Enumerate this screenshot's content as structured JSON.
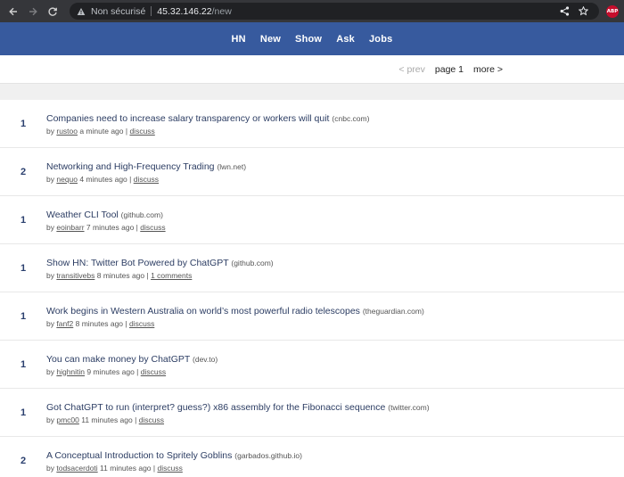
{
  "browser": {
    "insecure_label": "Non sécurisé",
    "host": "45.32.146.22",
    "path": "/new",
    "extension_label": "ABP"
  },
  "nav": {
    "items": [
      "HN",
      "New",
      "Show",
      "Ask",
      "Jobs"
    ]
  },
  "pager": {
    "prev": "< prev",
    "page": "page 1",
    "more": "more >"
  },
  "items": [
    {
      "score": "1",
      "title": "Companies need to increase salary transparency or workers will quit",
      "domain": "(cnbc.com)",
      "by": "by",
      "user": "rustoo",
      "time": "a minute ago |",
      "comments": "discuss"
    },
    {
      "score": "2",
      "title": "Networking and High-Frequency Trading",
      "domain": "(lwn.net)",
      "by": "by",
      "user": "nequo",
      "time": "4 minutes ago |",
      "comments": "discuss"
    },
    {
      "score": "1",
      "title": "Weather CLI Tool",
      "domain": "(github.com)",
      "by": "by",
      "user": "eoinbarr",
      "time": "7 minutes ago |",
      "comments": "discuss"
    },
    {
      "score": "1",
      "title": "Show HN: Twitter Bot Powered by ChatGPT",
      "domain": "(github.com)",
      "by": "by",
      "user": "transitivebs",
      "time": "8 minutes ago |",
      "comments": "1 comments"
    },
    {
      "score": "1",
      "title": "Work begins in Western Australia on world’s most powerful radio telescopes",
      "domain": "(theguardian.com)",
      "by": "by",
      "user": "fanf2",
      "time": "8 minutes ago |",
      "comments": "discuss"
    },
    {
      "score": "1",
      "title": "You can make money by ChatGPT",
      "domain": "(dev.to)",
      "by": "by",
      "user": "highnitin",
      "time": "9 minutes ago |",
      "comments": "discuss"
    },
    {
      "score": "1",
      "title": "Got ChatGPT to run (interpret? guess?) x86 assembly for the Fibonacci sequence",
      "domain": "(twitter.com)",
      "by": "by",
      "user": "pmc00",
      "time": "11 minutes ago |",
      "comments": "discuss"
    },
    {
      "score": "2",
      "title": "A Conceptual Introduction to Spritely Goblins",
      "domain": "(garbados.github.io)",
      "by": "by",
      "user": "todsacerdoti",
      "time": "11 minutes ago |",
      "comments": "discuss"
    }
  ]
}
